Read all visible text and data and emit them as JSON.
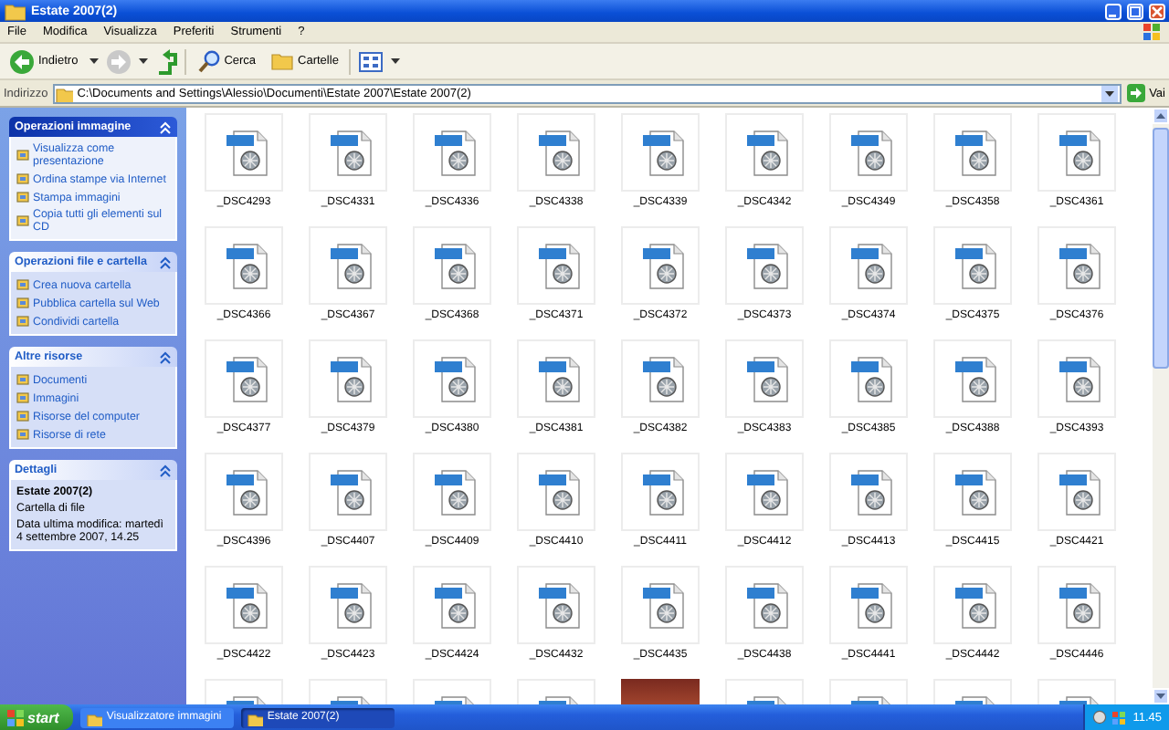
{
  "window": {
    "title": "Estate 2007(2)"
  },
  "menu": [
    "File",
    "Modifica",
    "Visualizza",
    "Preferiti",
    "Strumenti",
    "?"
  ],
  "toolbar": {
    "back": "Indietro",
    "search": "Cerca",
    "folders": "Cartelle"
  },
  "address": {
    "label": "Indirizzo",
    "value": "C:\\Documents and Settings\\Alessio\\Documenti\\Estate 2007\\Estate 2007(2)",
    "go": "Vai"
  },
  "sidebar": {
    "panels": [
      {
        "kind": "special",
        "title": "Operazioni immagine",
        "expanded": true,
        "items": [
          "Visualizza come presentazione",
          "Ordina stampe via Internet",
          "Stampa immagini",
          "Copia tutti gli elementi sul CD"
        ]
      },
      {
        "kind": "normal",
        "title": "Operazioni file e cartella",
        "expanded": true,
        "items": [
          "Crea nuova cartella",
          "Pubblica cartella sul Web",
          "Condividi cartella"
        ]
      },
      {
        "kind": "normal",
        "title": "Altre risorse",
        "expanded": true,
        "items": [
          "Documenti",
          "Immagini",
          "Risorse del computer",
          "Risorse di rete"
        ]
      },
      {
        "kind": "details",
        "title": "Dettagli",
        "expanded": true,
        "name": "Estate 2007(2)",
        "type": "Cartella di file",
        "modified": "Data ultima modifica: martedì 4 settembre 2007, 14.25"
      }
    ]
  },
  "files": [
    {
      "kind": "file",
      "label": "_DSC4293"
    },
    {
      "kind": "file",
      "label": "_DSC4331"
    },
    {
      "kind": "file",
      "label": "_DSC4336"
    },
    {
      "kind": "file",
      "label": "_DSC4338"
    },
    {
      "kind": "file",
      "label": "_DSC4339"
    },
    {
      "kind": "file",
      "label": "_DSC4342"
    },
    {
      "kind": "file",
      "label": "_DSC4349"
    },
    {
      "kind": "file",
      "label": "_DSC4358"
    },
    {
      "kind": "file",
      "label": "_DSC4361"
    },
    {
      "kind": "file",
      "label": "_DSC4366"
    },
    {
      "kind": "file",
      "label": "_DSC4367"
    },
    {
      "kind": "file",
      "label": "_DSC4368"
    },
    {
      "kind": "file",
      "label": "_DSC4371"
    },
    {
      "kind": "file",
      "label": "_DSC4372"
    },
    {
      "kind": "file",
      "label": "_DSC4373"
    },
    {
      "kind": "file",
      "label": "_DSC4374"
    },
    {
      "kind": "file",
      "label": "_DSC4375"
    },
    {
      "kind": "file",
      "label": "_DSC4376"
    },
    {
      "kind": "file",
      "label": "_DSC4377"
    },
    {
      "kind": "file",
      "label": "_DSC4379"
    },
    {
      "kind": "file",
      "label": "_DSC4380"
    },
    {
      "kind": "file",
      "label": "_DSC4381"
    },
    {
      "kind": "file",
      "label": "_DSC4382"
    },
    {
      "kind": "file",
      "label": "_DSC4383"
    },
    {
      "kind": "file",
      "label": "_DSC4385"
    },
    {
      "kind": "file",
      "label": "_DSC4388"
    },
    {
      "kind": "file",
      "label": "_DSC4393"
    },
    {
      "kind": "file",
      "label": "_DSC4396"
    },
    {
      "kind": "file",
      "label": "_DSC4407"
    },
    {
      "kind": "file",
      "label": "_DSC4409"
    },
    {
      "kind": "file",
      "label": "_DSC4410"
    },
    {
      "kind": "file",
      "label": "_DSC4411"
    },
    {
      "kind": "file",
      "label": "_DSC4412"
    },
    {
      "kind": "file",
      "label": "_DSC4413"
    },
    {
      "kind": "file",
      "label": "_DSC4415"
    },
    {
      "kind": "file",
      "label": "_DSC4421"
    },
    {
      "kind": "file",
      "label": "_DSC4422"
    },
    {
      "kind": "file",
      "label": "_DSC4423"
    },
    {
      "kind": "file",
      "label": "_DSC4424"
    },
    {
      "kind": "file",
      "label": "_DSC4432"
    },
    {
      "kind": "file",
      "label": "_DSC4435"
    },
    {
      "kind": "file",
      "label": "_DSC4438"
    },
    {
      "kind": "file",
      "label": "_DSC4441"
    },
    {
      "kind": "file",
      "label": "_DSC4442"
    },
    {
      "kind": "file",
      "label": "_DSC4446"
    },
    {
      "kind": "file"
    },
    {
      "kind": "file"
    },
    {
      "kind": "file"
    },
    {
      "kind": "file"
    },
    {
      "kind": "photo"
    },
    {
      "kind": "file"
    },
    {
      "kind": "file"
    },
    {
      "kind": "file"
    },
    {
      "kind": "file"
    }
  ],
  "taskbar": {
    "start": "start",
    "tasks": [
      {
        "label": "Visualizzatore immagini",
        "selected": false
      },
      {
        "label": "Estate 2007(2)",
        "selected": true
      }
    ],
    "clock": "11.45"
  }
}
